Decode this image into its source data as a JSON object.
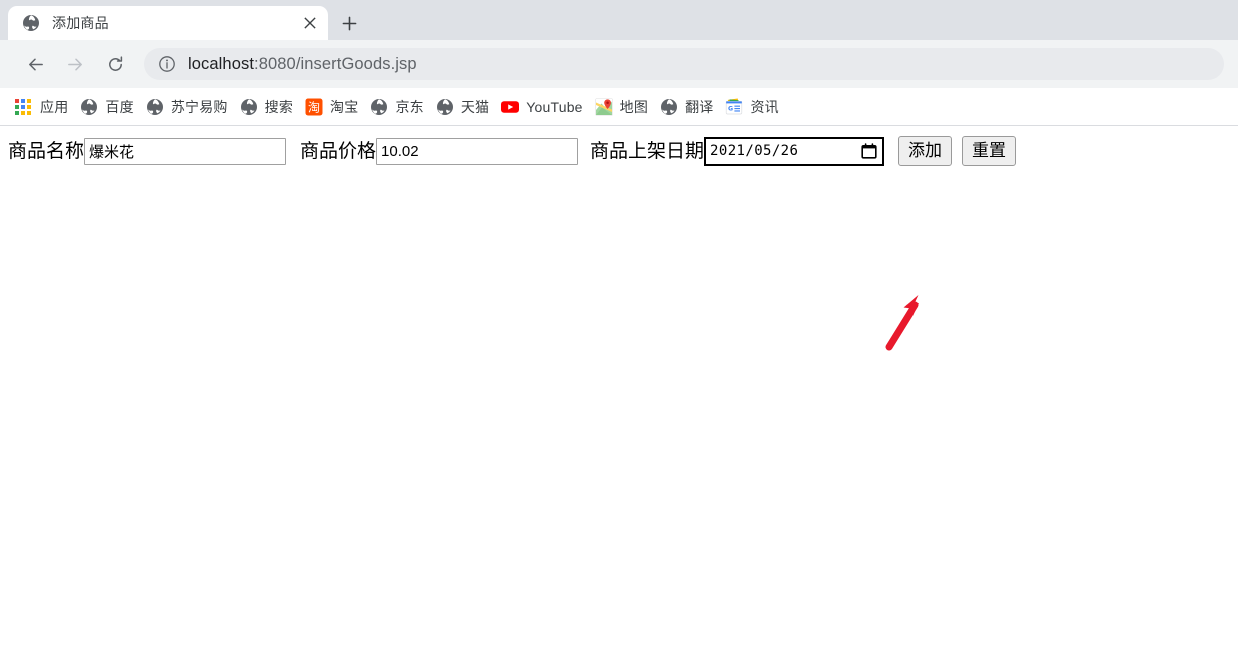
{
  "browser": {
    "tab": {
      "title": "添加商品",
      "favicon_icon": "globe-icon",
      "close_icon": "close-icon"
    },
    "newtab_icon": "plus-icon",
    "toolbar": {
      "back_icon": "arrow-left-icon",
      "forward_icon": "arrow-right-icon",
      "reload_icon": "reload-icon",
      "info_icon": "info-circle-icon",
      "url_host": "localhost",
      "url_path": ":8080/insertGoods.jsp"
    },
    "bookmarks": [
      {
        "label": "应用",
        "icon": "apps-grid-icon"
      },
      {
        "label": "百度",
        "icon": "globe-icon"
      },
      {
        "label": "苏宁易购",
        "icon": "globe-icon"
      },
      {
        "label": "搜索",
        "icon": "globe-icon"
      },
      {
        "label": "淘宝",
        "icon": "taobao-icon"
      },
      {
        "label": "京东",
        "icon": "globe-icon"
      },
      {
        "label": "天猫",
        "icon": "globe-icon"
      },
      {
        "label": "YouTube",
        "icon": "youtube-icon"
      },
      {
        "label": "地图",
        "icon": "google-maps-icon"
      },
      {
        "label": "翻译",
        "icon": "globe-icon"
      },
      {
        "label": "资讯",
        "icon": "google-news-icon"
      }
    ]
  },
  "page": {
    "form": {
      "name_label": "商品名称",
      "name_value": "爆米花",
      "name_placeholder": "",
      "price_label": "商品价格",
      "price_value": "10.02",
      "price_placeholder": "",
      "date_label": "商品上架日期",
      "date_value": "2021/05/26",
      "date_picker_icon": "calendar-icon",
      "submit_label": "添加",
      "reset_label": "重置"
    },
    "annotation": {
      "arrow_icon": "red-arrow-icon",
      "arrow_color": "#e8192c"
    }
  }
}
